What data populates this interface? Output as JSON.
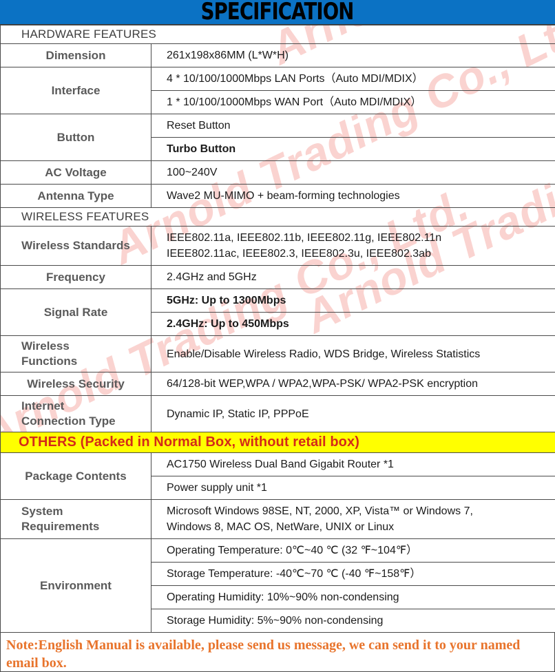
{
  "title": "SPECIFICATION",
  "sections": {
    "hardware_header": "HARDWARE FEATURES",
    "wireless_header": "WIRELESS FEATURES",
    "others_header": "OTHERS (Packed in Normal Box, without retail box)"
  },
  "rows": {
    "dimension": {
      "label": "Dimension",
      "value": "261x198x86MM (L*W*H)"
    },
    "interface": {
      "label": "Interface",
      "lan": "4 * 10/100/1000Mbps LAN Ports（Auto MDI/MDIX）",
      "wan": "1 * 10/100/1000Mbps WAN Port（Auto MDI/MDIX）"
    },
    "button": {
      "label": "Button",
      "reset": "Reset Button",
      "turbo": "Turbo Button"
    },
    "ac_voltage": {
      "label": "AC Voltage",
      "value": "100~240V"
    },
    "antenna_type": {
      "label": "Antenna Type",
      "value": "Wave2 MU-MIMO + beam-forming technologies"
    },
    "wireless_standards": {
      "label": "Wireless Standards",
      "line1": "IEEE802.11a, IEEE802.11b, IEEE802.11g, IEEE802.11n",
      "line2": "IEEE802.11ac, IEEE802.3, IEEE802.3u, IEEE802.3ab"
    },
    "frequency": {
      "label": "Frequency",
      "value": "2.4GHz and 5GHz"
    },
    "signal_rate": {
      "label": "Signal Rate",
      "ghz5": "5GHz: Up to 1300Mbps",
      "ghz24": "2.4GHz: Up to 450Mbps"
    },
    "wireless_functions": {
      "label_line1": "Wireless",
      "label_line2": "Functions",
      "value": "Enable/Disable Wireless Radio, WDS Bridge, Wireless Statistics"
    },
    "wireless_security": {
      "label": "Wireless Security",
      "value": "64/128-bit WEP,WPA / WPA2,WPA-PSK/ WPA2-PSK encryption"
    },
    "internet_connection_type": {
      "label_line1": "Internet",
      "label_line2": "Connection Type",
      "value": "Dynamic IP, Static IP, PPPoE"
    },
    "package_contents": {
      "label": "Package Contents",
      "item1": "AC1750 Wireless Dual Band Gigabit Router *1",
      "item2": "Power supply unit *1"
    },
    "system_requirements": {
      "label_line1": "System",
      "label_line2": "Requirements",
      "line1": "Microsoft Windows 98SE, NT, 2000, XP, Vista™ or Windows 7,",
      "line2": "Windows 8, MAC OS, NetWare, UNIX or Linux"
    },
    "environment": {
      "label": "Environment",
      "operating_temperature": "Operating Temperature: 0℃~40 ℃ (32 ℉~104℉）",
      "storage_temperature": "Storage Temperature: -40℃~70 ℃ (-40 ℉~158℉）",
      "operating_humidity": "Operating Humidity: 10%~90% non-condensing",
      "storage_humidity": "Storage Humidity: 5%~90% non-condensing"
    }
  },
  "note": "Note:English Manual is available, please send us message, we can send it to your named email box.",
  "watermark": {
    "text": "Arnold Trading Co., Ltd."
  },
  "colors": {
    "banner_blue": "#0b72c4",
    "others_yellow": "#ffff00",
    "others_red": "#d42a19",
    "note_orange": "#e8742c",
    "label_gray": "#5a5a5a",
    "watermark_pink": "#f7b9b4"
  }
}
